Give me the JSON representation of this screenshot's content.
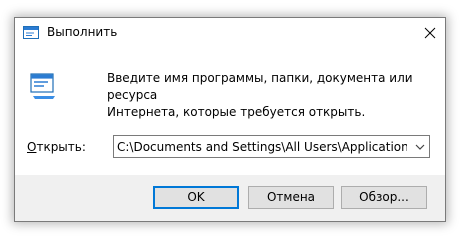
{
  "window": {
    "title": "Выполнить",
    "title_icon": "run-dialog-icon",
    "close_icon": "close-icon"
  },
  "content": {
    "icon": "run-dialog-icon",
    "description": "Введите имя программы, папки, документа или ресурса\nИнтернета, которые требуется открыть.",
    "open_label_accel": "О",
    "open_label_rest": "ткрыть:",
    "open_value": "C:\\Documents and Settings\\All Users\\Application Data\\"
  },
  "buttons": {
    "ok": "OK",
    "cancel": "Отмена",
    "browse": "Обзор..."
  },
  "colors": {
    "accent": "#0078d7",
    "footer_bg": "#f0f0f0",
    "button_bg": "#e1e1e1"
  }
}
